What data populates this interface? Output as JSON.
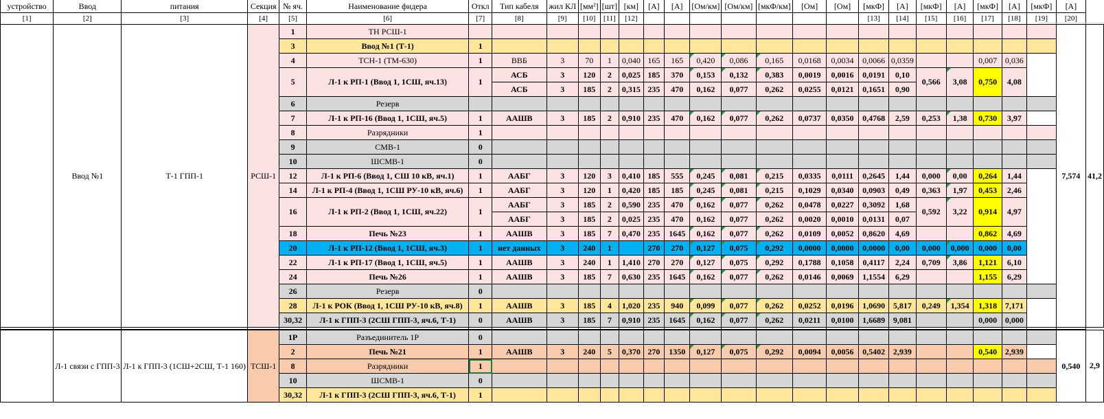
{
  "header": {
    "labels": [
      "устройство",
      "Ввод",
      "питания",
      "Секция",
      "№ яч.",
      "Наименование фидера",
      "Откл",
      "Тип кабеля",
      "жил КЛ",
      "[мм²]",
      "[шт]",
      "[км]",
      "[А]",
      "[А]",
      "[Ом/км]",
      "[Ом/км]",
      "[мкФ/км]",
      "[Ом]",
      "[Ом]",
      "[мкФ]",
      "[А]",
      "[мкФ]",
      "[А]",
      "[мкФ]",
      "[А]",
      "[мкФ]",
      "[А]"
    ],
    "indices": [
      "[1]",
      "[2]",
      "[3]",
      "[4]",
      "[5]",
      "[6]",
      "[7]",
      "[8]",
      "[9]",
      "[10]",
      "[11]",
      "[12]",
      "",
      "",
      "",
      "",
      "",
      "",
      "",
      "[13]",
      "[14]",
      "[15]",
      "[16]",
      "[17]",
      "[18]",
      "[19]",
      "[20]"
    ]
  },
  "group1": {
    "vvod": "Ввод №1",
    "source": "Т-1 ГПП-1",
    "section": "РСШ-1",
    "total_c": "7,574",
    "total_i": "41,2"
  },
  "group2": {
    "vvod": "Л-1 связи с ГПП-3",
    "source": "Л-1 к ГПП-3 (1СШ+2СШ, Т-1 160)",
    "section": "ТСШ-1",
    "total_c": "0,540",
    "total_i": "2,9"
  },
  "rows": [
    {
      "cells": [
        "1",
        "ТН РСШ-1",
        "",
        "",
        "",
        "",
        "",
        "",
        "",
        "",
        "",
        "",
        "",
        "",
        "",
        "",
        "",
        "",
        "",
        "",
        "",
        ""
      ],
      "cls": "c-pink",
      "bold": false
    },
    {
      "cells": [
        "3",
        "Ввод №1 (Т-1)",
        "1",
        "",
        "",
        "",
        "",
        "",
        "",
        "",
        "",
        "",
        "",
        "",
        "",
        "",
        "",
        "",
        "",
        "",
        "",
        ""
      ],
      "cls": "c-gold",
      "bold": true
    },
    {
      "cells": [
        "4",
        "ТСН-1 (ТМ-630)",
        "1",
        "ВВБ",
        "3",
        "70",
        "1",
        "0,040",
        "165",
        "165",
        "0,420",
        "0,086",
        "0,165",
        "0,0168",
        "0,0034",
        "0,0066",
        "0,0359",
        "",
        "",
        "0,007",
        "0,036"
      ],
      "cls": "c-pink",
      "bold": false
    },
    {
      "cells": [
        "5",
        "Л-1 к РП-1 (Ввод 1, 1СШ, яч.13)",
        "1",
        "АСБ",
        "3",
        "120",
        "2",
        "0,025",
        "185",
        "370",
        "0,153",
        "0,132",
        "0,383",
        "0,0019",
        "0,0016",
        "0,0191",
        "0,10",
        "0,566",
        "3,08",
        "0,750",
        "4,08"
      ],
      "cls": "c-pink",
      "bold": true
    },
    {
      "cells": [
        "АСБ",
        "3",
        "185",
        "2",
        "0,315",
        "235",
        "470",
        "0,162",
        "0,077",
        "0,262",
        "0,0255",
        "0,0121",
        "0,1651",
        "0,90"
      ],
      "cls": "c-pink",
      "bold": true
    },
    {
      "cells": [
        "6",
        "Резерв",
        "",
        "",
        "",
        "",
        "",
        "",
        "",
        "",
        "",
        "",
        "",
        "",
        "",
        "",
        "",
        "",
        "",
        "",
        "",
        ""
      ],
      "cls": "c-grey",
      "bold": false
    },
    {
      "cells": [
        "7",
        "Л-1 к РП-16 (Ввод 1, 1СШ, яч.5)",
        "1",
        "ААШВ",
        "3",
        "185",
        "2",
        "0,910",
        "235",
        "470",
        "0,162",
        "0,077",
        "0,262",
        "0,0737",
        "0,0350",
        "0,4768",
        "2,59",
        "0,253",
        "1,38",
        "0,730",
        "3,97"
      ],
      "cls": "c-pink",
      "bold": true
    },
    {
      "cells": [
        "8",
        "Разрядники",
        "1",
        "",
        "",
        "",
        "",
        "",
        "",
        "",
        "",
        "",
        "",
        "",
        "",
        "",
        "",
        "",
        "",
        "",
        "",
        ""
      ],
      "cls": "c-pink",
      "bold": false
    },
    {
      "cells": [
        "9",
        "СМВ-1",
        "0",
        "",
        "",
        "",
        "",
        "",
        "",
        "",
        "",
        "",
        "",
        "",
        "",
        "",
        "",
        "",
        "",
        "",
        "",
        ""
      ],
      "cls": "c-grey",
      "bold": false
    },
    {
      "cells": [
        "10",
        "ШСМВ-1",
        "0",
        "",
        "",
        "",
        "",
        "",
        "",
        "",
        "",
        "",
        "",
        "",
        "",
        "",
        "",
        "",
        "",
        "",
        "",
        ""
      ],
      "cls": "c-grey",
      "bold": false
    },
    {
      "cells": [
        "12",
        "Л-1 к РП-6 (Ввод 1, СШ 10 кВ, яч.1)",
        "1",
        "ААБГ",
        "3",
        "120",
        "3",
        "0,410",
        "185",
        "555",
        "0,245",
        "0,081",
        "0,215",
        "0,0335",
        "0,0111",
        "0,2645",
        "1,44",
        "0,000",
        "0,00",
        "0,264",
        "1,44"
      ],
      "cls": "c-pink",
      "bold": true
    },
    {
      "cells": [
        "14",
        "Л-1 к РП-4 (Ввод 1, 1СШ РУ-10 кВ, яч.6)",
        "1",
        "ААБГ",
        "3",
        "120",
        "1",
        "0,420",
        "185",
        "185",
        "0,245",
        "0,081",
        "0,215",
        "0,1029",
        "0,0340",
        "0,0903",
        "0,49",
        "0,363",
        "1,97",
        "0,453",
        "2,46"
      ],
      "cls": "c-pink",
      "bold": true
    },
    {
      "cells": [
        "16",
        "Л-1 к РП-2 (Ввод 1, 1СШ, яч.22)",
        "1",
        "ААБГ",
        "3",
        "185",
        "2",
        "0,590",
        "235",
        "470",
        "0,162",
        "0,077",
        "0,262",
        "0,0478",
        "0,0227",
        "0,3092",
        "1,68",
        "0,592",
        "3,22",
        "0,914",
        "4,97"
      ],
      "cls": "c-pink",
      "bold": true
    },
    {
      "cells": [
        "ААБГ",
        "3",
        "185",
        "2",
        "0,025",
        "235",
        "470",
        "0,162",
        "0,077",
        "0,262",
        "0,0020",
        "0,0010",
        "0,0131",
        "0,07"
      ],
      "cls": "c-pink",
      "bold": true
    },
    {
      "cells": [
        "18",
        "Печь №23",
        "1",
        "ААШВ",
        "3",
        "185",
        "7",
        "0,470",
        "235",
        "1645",
        "0,162",
        "0,077",
        "0,262",
        "0,0109",
        "0,0052",
        "0,8620",
        "4,69",
        "",
        "",
        "0,862",
        "4,69"
      ],
      "cls": "c-pink",
      "bold": true
    },
    {
      "cells": [
        "20",
        "Л-1 к РП-12 (Ввод 1, 1СШ, яч.3)",
        "1",
        "нет данных",
        "3",
        "240",
        "1",
        "",
        "270",
        "270",
        "0,127",
        "0,075",
        "0,292",
        "0,0000",
        "0,0000",
        "0,0000",
        "0,00",
        "0,000",
        "0,000",
        "0,000",
        "0,00"
      ],
      "cls": "c-cyan",
      "bold": true
    },
    {
      "cells": [
        "22",
        "Л-1 к РП-17 (Ввод 1, 1СШ, яч.5)",
        "1",
        "ААШВ",
        "3",
        "240",
        "1",
        "1,410",
        "270",
        "270",
        "0,127",
        "0,075",
        "0,292",
        "0,1788",
        "0,1058",
        "0,4117",
        "2,24",
        "0,709",
        "3,86",
        "1,121",
        "6,10"
      ],
      "cls": "c-pink",
      "bold": true
    },
    {
      "cells": [
        "24",
        "Печь №26",
        "1",
        "ААШВ",
        "3",
        "185",
        "7",
        "0,630",
        "235",
        "1645",
        "0,162",
        "0,077",
        "0,262",
        "0,0146",
        "0,0069",
        "1,1554",
        "6,29",
        "",
        "",
        "1,155",
        "6,29"
      ],
      "cls": "c-pink",
      "bold": true
    },
    {
      "cells": [
        "26",
        "Резерв",
        "0",
        "",
        "",
        "",
        "",
        "",
        "",
        "",
        "",
        "",
        "",
        "",
        "",
        "",
        "",
        "",
        "",
        "",
        "",
        ""
      ],
      "cls": "c-grey",
      "bold": false
    },
    {
      "cells": [
        "28",
        "Л-1 к РОК (Ввод 1, 1СШ РУ-10 кВ, яч.8)",
        "1",
        "ААШВ",
        "3",
        "185",
        "4",
        "1,020",
        "235",
        "940",
        "0,099",
        "0,077",
        "0,262",
        "0,0252",
        "0,0196",
        "1,0690",
        "5,817",
        "0,249",
        "1,354",
        "1,318",
        "7,171"
      ],
      "cls": "c-gold",
      "bold": true
    },
    {
      "cells": [
        "30,32",
        "Л-1 к ГПП-3 (2СШ ГПП-3, яч.6, Т-1)",
        "0",
        "ААШВ",
        "3",
        "185",
        "7",
        "0,910",
        "235",
        "1645",
        "0,162",
        "0,077",
        "0,262",
        "0,0211",
        "0,0100",
        "1,6689",
        "9,081",
        "",
        "",
        "0,000",
        "0,000"
      ],
      "cls": "c-grey",
      "bold": true
    },
    {
      "cells": [
        "1Р",
        "Разъединитель 1Р",
        "0",
        "",
        "",
        "",
        "",
        "",
        "",
        "",
        "",
        "",
        "",
        "",
        "",
        "",
        "",
        "",
        "",
        "",
        "",
        ""
      ],
      "cls": "c-grey",
      "bold": false
    },
    {
      "cells": [
        "2",
        "Печь №21",
        "1",
        "ААШВ",
        "3",
        "240",
        "5",
        "0,370",
        "270",
        "1350",
        "0,127",
        "0,075",
        "0,292",
        "0,0094",
        "0,0056",
        "0,5402",
        "2,939",
        "",
        "",
        "0,540",
        "2,939"
      ],
      "cls": "c-peach",
      "bold": true
    },
    {
      "cells": [
        "8",
        "Разрядники",
        "1",
        "",
        "",
        "",
        "",
        "",
        "",
        "",
        "",
        "",
        "",
        "",
        "",
        "",
        "",
        "",
        "",
        "",
        "",
        ""
      ],
      "cls": "c-peach",
      "bold": false
    },
    {
      "cells": [
        "10",
        "ШСМВ-1",
        "0",
        "",
        "",
        "",
        "",
        "",
        "",
        "",
        "",
        "",
        "",
        "",
        "",
        "",
        "",
        "",
        "",
        "",
        "",
        ""
      ],
      "cls": "c-grey",
      "bold": false
    },
    {
      "cells": [
        "30,32",
        "Л-1 к ГПП-3 (2СШ ГПП-3, яч.6, Т-1)",
        "1",
        "",
        "",
        "",
        "",
        "",
        "",
        "",
        "",
        "",
        "",
        "",
        "",
        "",
        "",
        "",
        "",
        "",
        "",
        ""
      ],
      "cls": "c-gold",
      "bold": true
    }
  ],
  "colors": {
    "pink": "#fde2e3",
    "gold": "#ffe699",
    "grey": "#d6d6d6",
    "cyan": "#00b0f0",
    "peach": "#f8cbad",
    "highlight": "#ffff00",
    "red_text": "#e00000"
  }
}
